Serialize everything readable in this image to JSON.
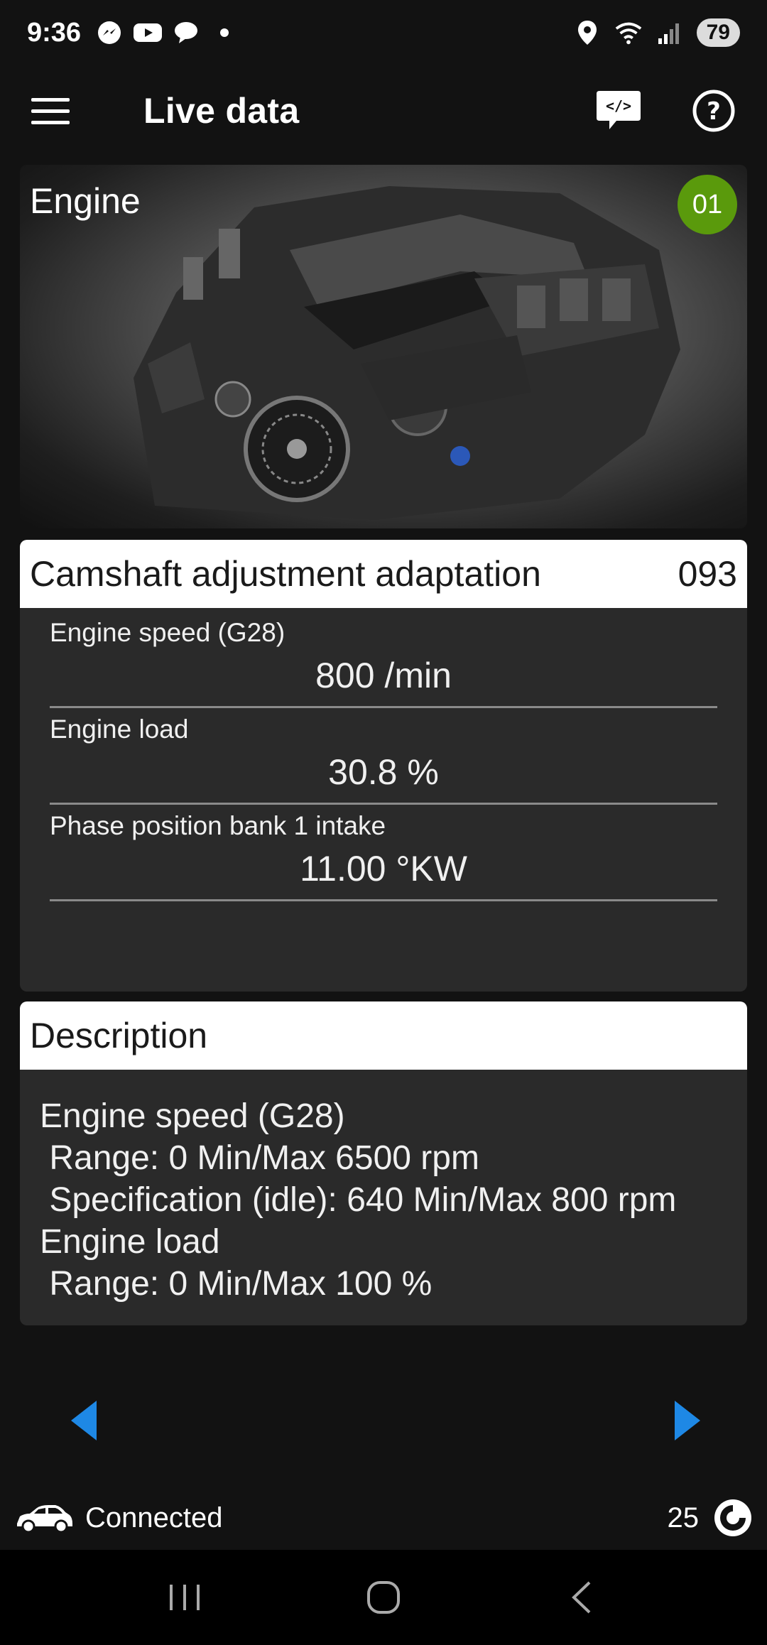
{
  "status_bar": {
    "time": "9:36",
    "battery": "79",
    "icons": [
      "messenger-icon",
      "youtube-icon",
      "chat-icon",
      "dot-icon",
      "location-icon",
      "wifi-icon",
      "signal-icon"
    ]
  },
  "app_bar": {
    "title": "Live data",
    "menu_icon": "hamburger-icon",
    "code_icon": "code-icon",
    "help_icon": "help-icon"
  },
  "engine_card": {
    "label": "Engine",
    "badge": "01",
    "badge_color": "#5a9a0c"
  },
  "group": {
    "title": "Camshaft adjustment adaptation",
    "number": "093",
    "params": [
      {
        "label": "Engine speed (G28)",
        "value": "800 /min"
      },
      {
        "label": "Engine load",
        "value": "30.8 %"
      },
      {
        "label": "Phase position bank 1 intake",
        "value": "11.00 °KW"
      }
    ]
  },
  "description": {
    "title": "Description",
    "lines": [
      "Engine speed (G28)",
      " Range: 0 Min/Max 6500 rpm",
      " Specification (idle): 640 Min/Max 800 rpm",
      "Engine load",
      " Range: 0 Min/Max 100 %"
    ]
  },
  "navigation": {
    "prev_icon": "arrow-left-icon",
    "next_icon": "arrow-right-icon",
    "arrow_color": "#1e88e5"
  },
  "footer": {
    "status": "Connected",
    "count": "25"
  },
  "system_nav": {
    "recents": "recents-icon",
    "home": "home-icon",
    "back": "back-icon"
  }
}
